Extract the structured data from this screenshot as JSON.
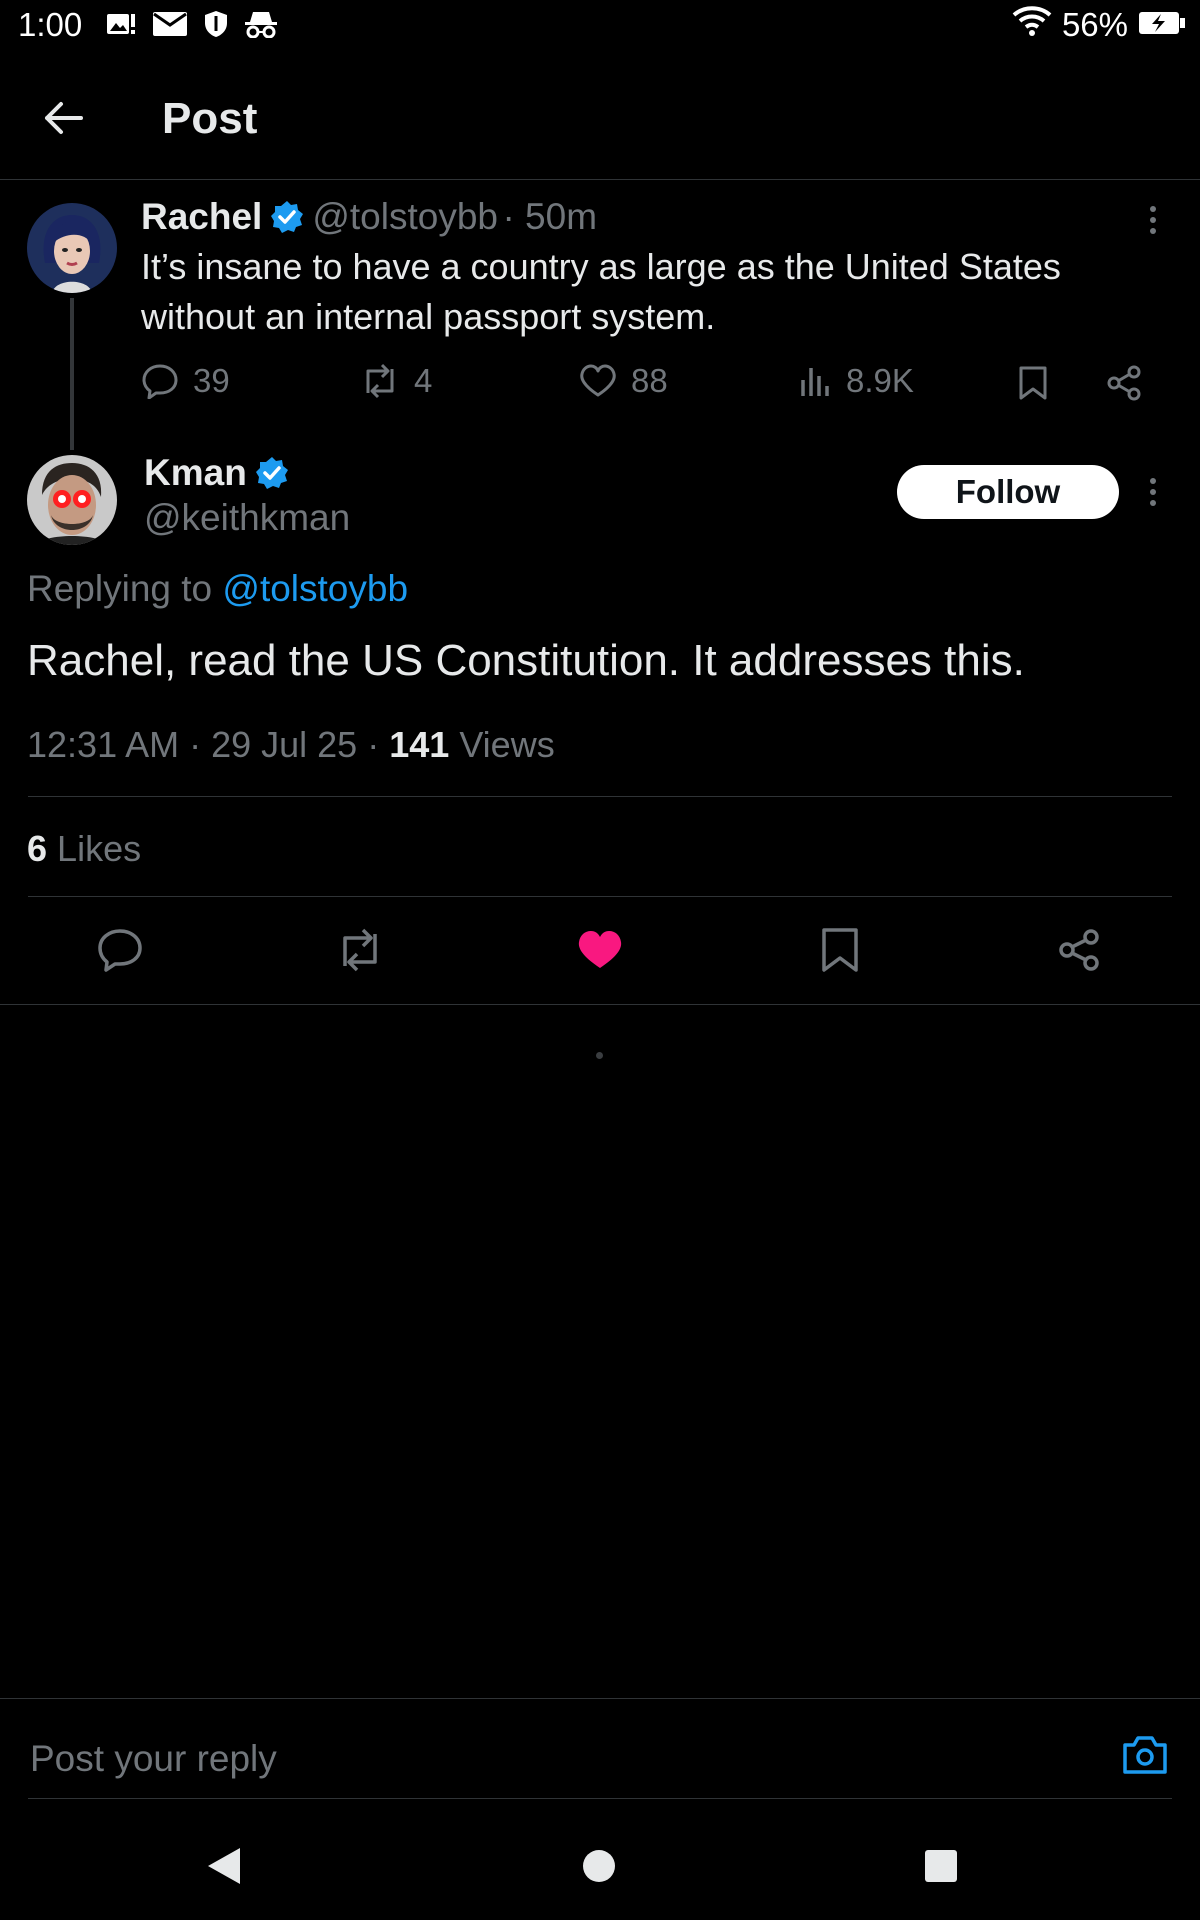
{
  "status_bar": {
    "time": "1:00",
    "battery": "56%",
    "left_icons": [
      "gallery-alert-icon",
      "mail-icon",
      "shield-icon",
      "incognito-icon"
    ],
    "right_icons": [
      "wifi-icon",
      "battery-charging-icon"
    ]
  },
  "header": {
    "title": "Post"
  },
  "parent_post": {
    "name": "Rachel",
    "handle": "@tolstoybb",
    "time": "· 50m",
    "text": "It’s insane to have a country as large as the United States without an internal passport system.",
    "replies": "39",
    "reposts": "4",
    "likes": "88",
    "views": "8.9K"
  },
  "main_post": {
    "name": "Kman",
    "handle": "@keithkman",
    "follow_label": "Follow",
    "replying_prefix": "Replying to",
    "replying_to": "@tolstoybb",
    "text": "Rachel, read the US Constitution. It addresses this.",
    "timestamp": "12:31 AM · 29 Jul 25 ·",
    "views_count": "141",
    "views_label": "Views",
    "likes_count": "6",
    "likes_label": "Likes",
    "liked": true
  },
  "reply_box": {
    "placeholder": "Post your reply"
  },
  "colors": {
    "accent": "#1d9bf0",
    "like": "#f91880",
    "background": "#000000",
    "secondary_text": "#71767b"
  }
}
